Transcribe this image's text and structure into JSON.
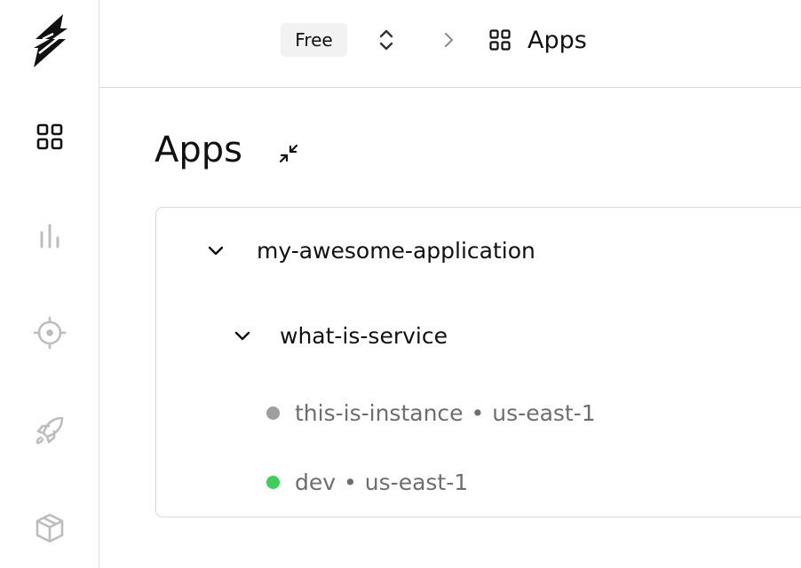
{
  "header": {
    "plan_label": "Free",
    "breadcrumb_label": "Apps"
  },
  "page": {
    "title": "Apps"
  },
  "tree": {
    "app": {
      "name": "my-awesome-application"
    },
    "service": {
      "name": "what-is-service"
    },
    "instances": [
      {
        "name": "this-is-instance",
        "separator": "•",
        "region": "us-east-1",
        "status_color": "#9e9e9e"
      },
      {
        "name": "dev",
        "separator": "•",
        "region": "us-east-1",
        "status_color": "#3ecf5a"
      }
    ]
  },
  "colors": {
    "active_icon": "#111111",
    "inactive_icon": "#bdbdbd",
    "border": "#d8d8d8"
  },
  "icons": {
    "logo": "lightning-logo",
    "nav": [
      "apps-grid-icon",
      "bar-chart-icon",
      "target-icon",
      "rocket-icon",
      "package-icon"
    ]
  }
}
